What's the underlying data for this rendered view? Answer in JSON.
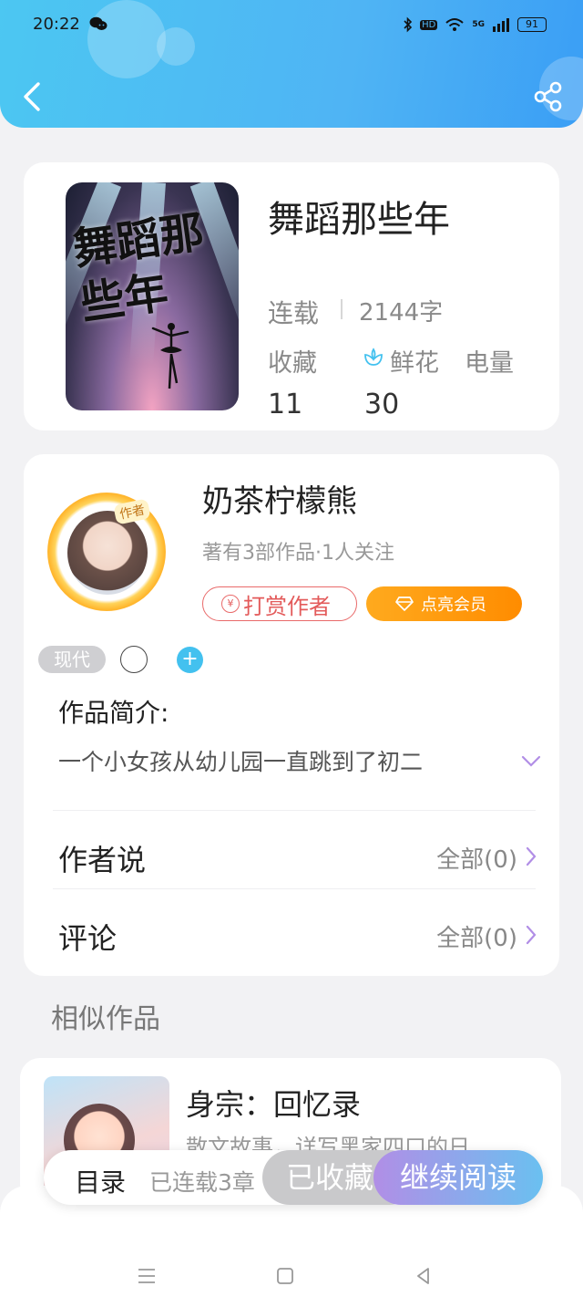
{
  "status_bar": {
    "time": "20:22",
    "network": "5G",
    "hd": "HD",
    "battery": "91"
  },
  "book": {
    "title": "舞蹈那些年",
    "cover_title": "舞蹈那些年",
    "status": "连载",
    "word_count": "2144字",
    "stats": [
      {
        "label": "收藏",
        "value": "11"
      },
      {
        "label": "鲜花",
        "value": "30"
      },
      {
        "label": "电量",
        "value": ""
      }
    ]
  },
  "author": {
    "name": "奶茶柠檬熊",
    "badge": "作者",
    "meta": "著有3部作品·1人关注",
    "reward_label": "打赏作者",
    "reward_icon": "¥",
    "vip_label": "点亮会员",
    "tags": [
      "现代"
    ],
    "add_tag": "+"
  },
  "intro": {
    "label": "作品简介:",
    "text": "一个小女孩从幼儿园一直跳到了初二"
  },
  "author_says": {
    "label": "作者说",
    "right": "全部(0)"
  },
  "comments": {
    "label": "评论",
    "right": "全部(0)"
  },
  "similar": {
    "section_title": "相似作品",
    "items": [
      {
        "title": "身宗：回忆录",
        "desc": "散文故事，详写黑家四口的日..."
      }
    ]
  },
  "action_bar": {
    "toc": "目录",
    "serial": "已连载3章",
    "collected": "已收藏",
    "continue": "继续阅读"
  },
  "colors": {
    "header_start": "#4cc7f2",
    "header_end": "#3a9ef5",
    "reward_red": "#e35b5b",
    "vip_orange": "#ff9a10",
    "accent_purple": "#b18ee6",
    "tag_blue": "#43c1ef"
  }
}
